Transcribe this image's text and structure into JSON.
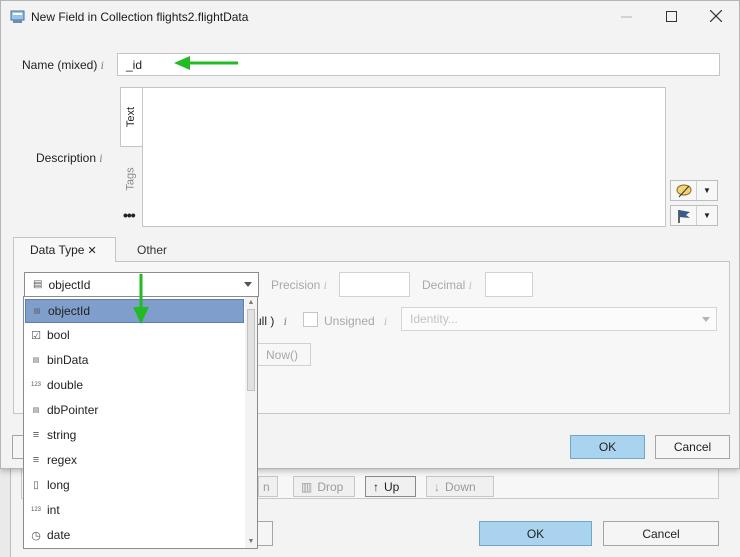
{
  "window": {
    "title": "New Field in Collection flights2.flightData"
  },
  "form": {
    "name_label": "Name (mixed)",
    "name_value": "_id",
    "description_label": "Description",
    "vtab_text": "Text",
    "vtab_tags": "Tags",
    "more": "•••",
    "info_glyph": "i"
  },
  "tabs": {
    "datatype": "Data Type",
    "datatype_close": "✕",
    "other": "Other"
  },
  "datatype": {
    "selected": "objectId",
    "precision_label": "Precision",
    "decimal_label": "Decimal",
    "null_label": "ull )",
    "unsigned_label": "Unsigned",
    "identity_placeholder": "Identity...",
    "now_label": "Now()"
  },
  "dropdown": {
    "items": [
      {
        "label": "objectId",
        "icon": "db-icon",
        "glyph": "▤"
      },
      {
        "label": "bool",
        "icon": "checkbox-icon",
        "glyph": "☑"
      },
      {
        "label": "binData",
        "icon": "db-icon",
        "glyph": "▤"
      },
      {
        "label": "double",
        "icon": "number-icon",
        "glyph": "123"
      },
      {
        "label": "dbPointer",
        "icon": "db-icon",
        "glyph": "▤"
      },
      {
        "label": "string",
        "icon": "text-lines-icon",
        "glyph": "≡"
      },
      {
        "label": "regex",
        "icon": "text-lines-icon",
        "glyph": "≡"
      },
      {
        "label": "long",
        "icon": "document-icon",
        "glyph": "▯"
      },
      {
        "label": "int",
        "icon": "number-icon",
        "glyph": "123"
      },
      {
        "label": "date",
        "icon": "clock-icon",
        "glyph": "◷"
      }
    ]
  },
  "buttons": {
    "ok": "OK",
    "cancel": "Cancel"
  },
  "background_window": {
    "drop": "Drop",
    "up": "Up",
    "down": "Down",
    "partial": "n",
    "ok": "OK",
    "cancel": "Cancel"
  },
  "colors": {
    "ok_bg": "#a9d3ee",
    "selection_bg": "#7f9ecb",
    "annotation_arrow": "#22bb22"
  }
}
